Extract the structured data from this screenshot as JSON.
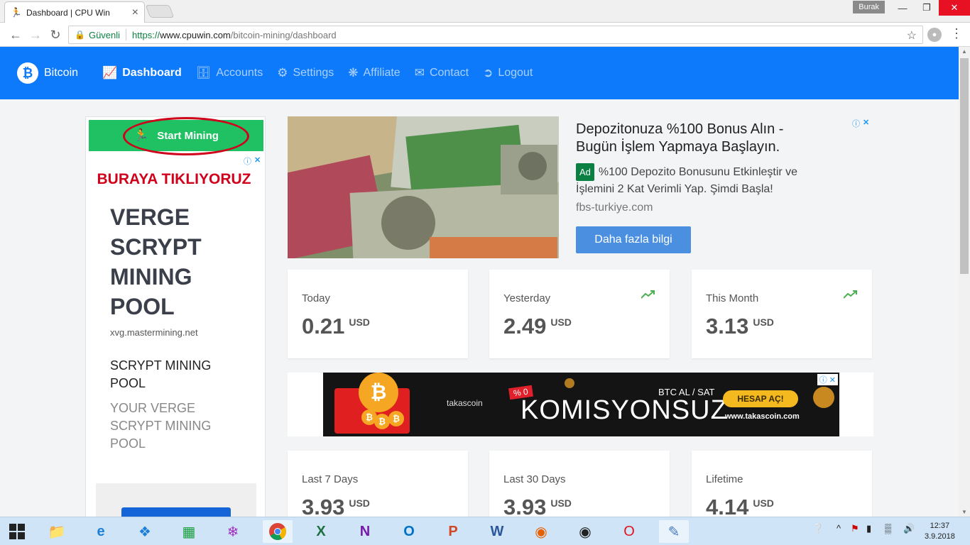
{
  "browser": {
    "tab_title": "Dashboard | CPU Win",
    "tab_close": "×",
    "user": "Burak",
    "secure_label": "Güvenli",
    "url_scheme": "https://",
    "url_host": "www.cpuwin.com",
    "url_path": "/bitcoin-mining/dashboard"
  },
  "site_nav": {
    "brand": "Bitcoin",
    "items": [
      {
        "label": "Dashboard",
        "icon": "chart-icon",
        "active": true
      },
      {
        "label": "Accounts",
        "icon": "accounts-icon"
      },
      {
        "label": "Settings",
        "icon": "gear-icon"
      },
      {
        "label": "Affiliate",
        "icon": "network-icon"
      },
      {
        "label": "Contact",
        "icon": "envelope-icon"
      },
      {
        "label": "Logout",
        "icon": "logout-icon"
      }
    ]
  },
  "sidebar": {
    "start_mining": "Start Mining",
    "annotation": "BURAYA TIKLIYORUZ",
    "ad": {
      "headline": "VERGE SCRYPT MINING POOL",
      "domain": "xvg.mastermining.net",
      "subtitle": "SCRYPT MINING POOL",
      "description": "YOUR VERGE SCRYPT MINING POOL"
    }
  },
  "top_ad": {
    "title": "Depozitonuza %100 Bonus Alın - Bugün İşlem Yapmaya Başlayın.",
    "badge": "Ad",
    "text": "%100 Depozito Bonusunu Etkinleştir ve İşlemini 2 Kat Verimli Yap. Şimdi Başla!",
    "host": "fbs-turkiye.com",
    "button": "Daha fazla bilgi"
  },
  "stats": [
    {
      "label": "Today",
      "value": "0.21",
      "unit": "USD",
      "trend": false
    },
    {
      "label": "Yesterday",
      "value": "2.49",
      "unit": "USD",
      "trend": true
    },
    {
      "label": "This Month",
      "value": "3.13",
      "unit": "USD",
      "trend": true
    },
    {
      "label": "Last 7 Days",
      "value": "3.93",
      "unit": "USD",
      "trend": false
    },
    {
      "label": "Last 30 Days",
      "value": "3.93",
      "unit": "USD",
      "trend": false
    },
    {
      "label": "Lifetime",
      "value": "4.14",
      "unit": "USD",
      "trend": false
    }
  ],
  "banner_ad": {
    "brand": "takascoin",
    "percent": "% 0",
    "headline": "KOMISYONSUZ",
    "tagline": "BTC AL / SAT",
    "button": "HESAP AÇ!",
    "url": "www.takascoin.com"
  },
  "taskbar": {
    "time": "12:37",
    "date": "3.9.2018"
  },
  "colors": {
    "nav_blue": "#0d79fb",
    "start_green": "#20c163",
    "annotation_red": "#d0021b"
  }
}
